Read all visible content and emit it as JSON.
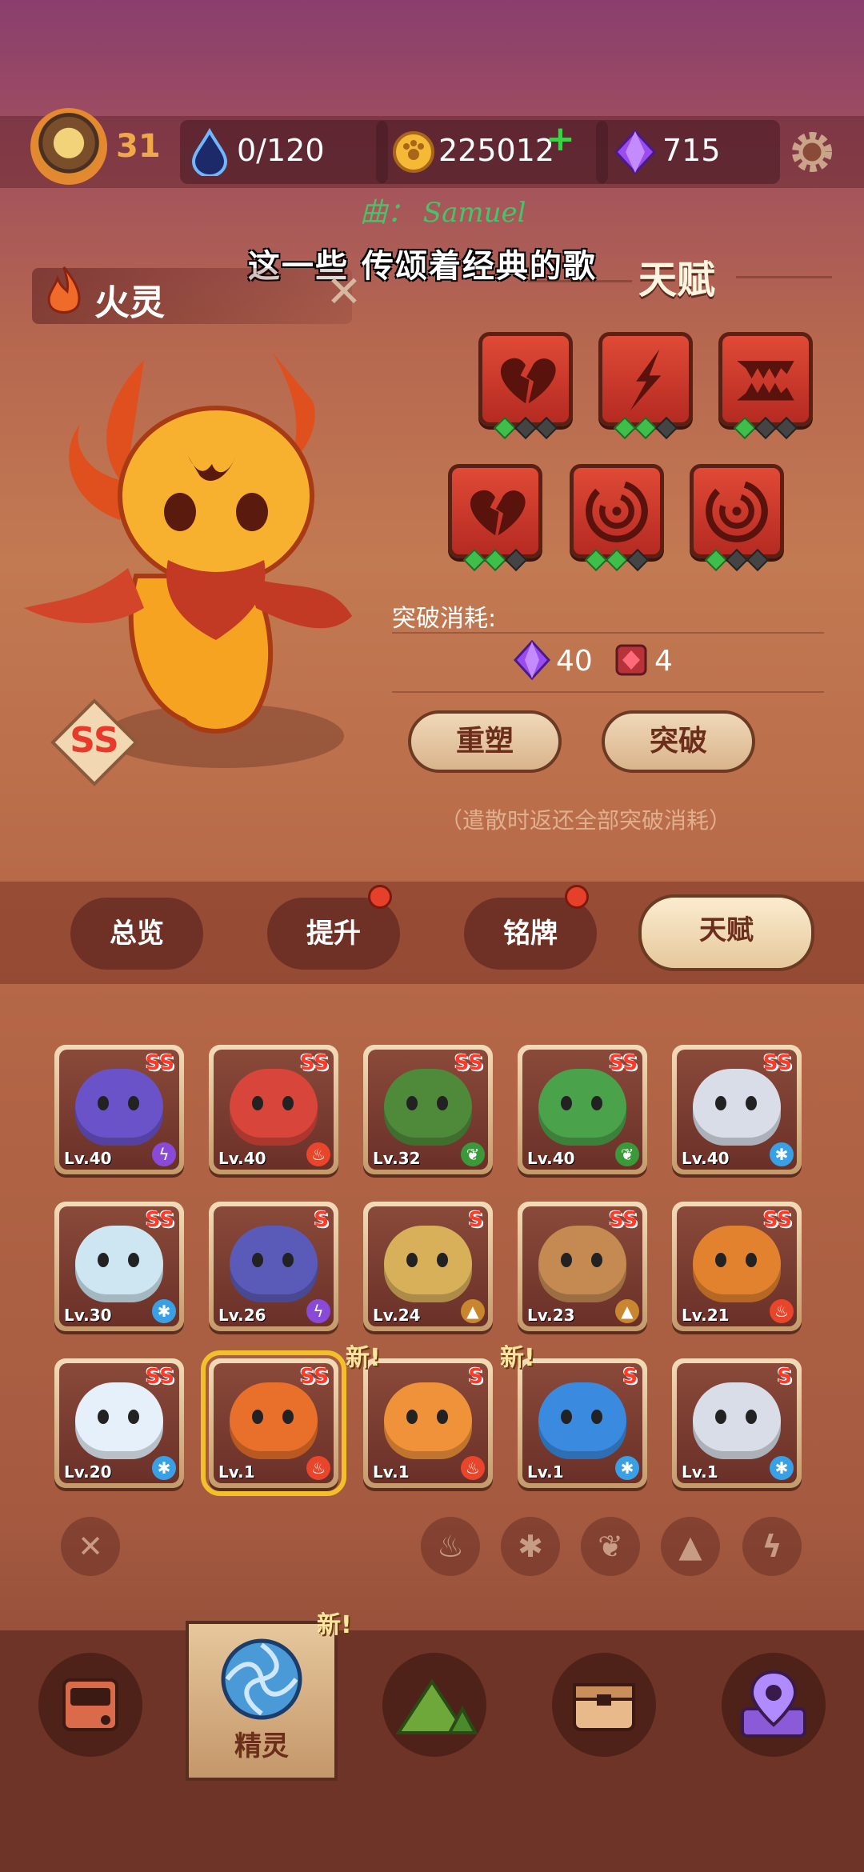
{
  "header": {
    "level": "31",
    "stamina": "0/120",
    "coins": "225012",
    "gems": "715"
  },
  "overlay": {
    "credit": "曲： Samuel",
    "lyric": "这一些 传颂着经典的歌"
  },
  "spirit": {
    "element_name": "火灵",
    "rank": "SS"
  },
  "talent": {
    "title": "天赋",
    "icons": [
      {
        "icon": "broken-heart-icon",
        "pips": [
          1,
          0,
          0
        ]
      },
      {
        "icon": "slash-icon",
        "pips": [
          1,
          1,
          0
        ]
      },
      {
        "icon": "fangs-icon",
        "pips": [
          1,
          0,
          0
        ]
      },
      {
        "icon": "broken-heart-icon",
        "pips": [
          1,
          1,
          0
        ]
      },
      {
        "icon": "swirl-icon",
        "pips": [
          1,
          1,
          0
        ]
      },
      {
        "icon": "swirl-icon",
        "pips": [
          1,
          0,
          0
        ]
      }
    ],
    "cost_label": "突破消耗:",
    "cost_gems": "40",
    "cost_items": "4",
    "reshape_label": "重塑",
    "breakthrough_label": "突破",
    "note": "（遣散时返还全部突破消耗）"
  },
  "tabs": [
    {
      "label": "总览",
      "dot": false,
      "active": false
    },
    {
      "label": "提升",
      "dot": true,
      "active": false
    },
    {
      "label": "铭牌",
      "dot": true,
      "active": false
    },
    {
      "label": "天赋",
      "dot": false,
      "active": true
    }
  ],
  "roster": [
    {
      "rank": "SS",
      "level": "Lv.40",
      "element": "lightning",
      "color": "#6a52c8"
    },
    {
      "rank": "SS",
      "level": "Lv.40",
      "element": "fire",
      "color": "#d8453a"
    },
    {
      "rank": "SS",
      "level": "Lv.32",
      "element": "leaf",
      "color": "#4f8a3a"
    },
    {
      "rank": "SS",
      "level": "Lv.40",
      "element": "leaf",
      "color": "#4aa24a"
    },
    {
      "rank": "SS",
      "level": "Lv.40",
      "element": "ice",
      "color": "#d8dde8"
    },
    {
      "rank": "SS",
      "level": "Lv.30",
      "element": "ice",
      "color": "#cde6f2"
    },
    {
      "rank": "S",
      "level": "Lv.26",
      "element": "lightning",
      "color": "#5a5ab8"
    },
    {
      "rank": "S",
      "level": "Lv.24",
      "element": "earth",
      "color": "#d8b05a"
    },
    {
      "rank": "SS",
      "level": "Lv.23",
      "element": "earth",
      "color": "#c48a52"
    },
    {
      "rank": "SS",
      "level": "Lv.21",
      "element": "fire",
      "color": "#e2822e"
    },
    {
      "rank": "SS",
      "level": "Lv.20",
      "element": "ice",
      "color": "#e6f0fa"
    },
    {
      "rank": "SS",
      "level": "Lv.1",
      "element": "fire",
      "color": "#e8702a",
      "selected": true
    },
    {
      "rank": "S",
      "level": "Lv.1",
      "element": "fire",
      "color": "#f0923a",
      "new": "新!"
    },
    {
      "rank": "S",
      "level": "Lv.1",
      "element": "ice",
      "color": "#3a8ae0",
      "new": "新!"
    },
    {
      "rank": "S",
      "level": "Lv.1",
      "element": "ice",
      "color": "#d8dde8"
    }
  ],
  "element_colors": {
    "fire": "#e8452a",
    "ice": "#3aa0e6",
    "leaf": "#3a9a3a",
    "lightning": "#8a4ad8",
    "earth": "#c8862e"
  },
  "filters": [
    "close",
    "fire",
    "ice",
    "leaf",
    "earth",
    "lightning"
  ],
  "nav": {
    "active_label": "精灵",
    "new_tag": "新!"
  }
}
